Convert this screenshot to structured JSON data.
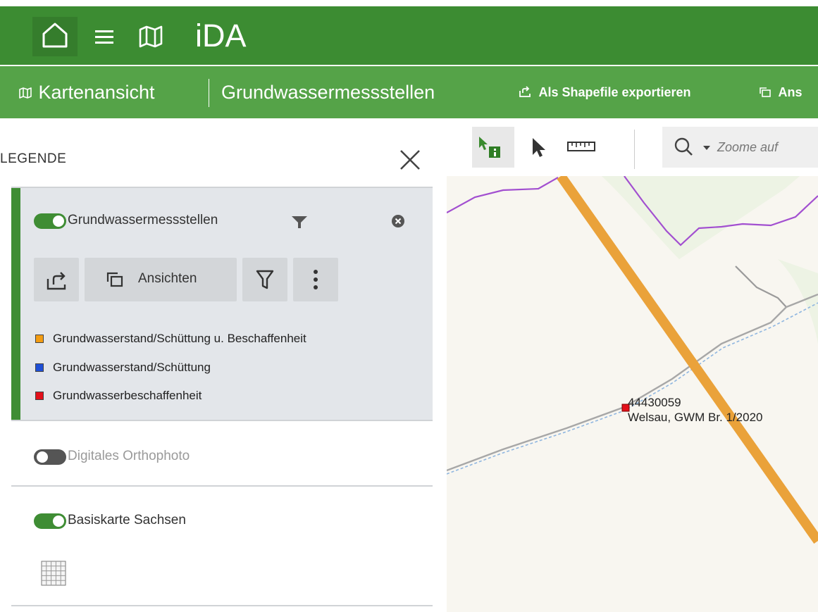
{
  "app": {
    "title": "iDA"
  },
  "subnav": {
    "view_label": "Kartenansicht",
    "dataset_title": "Grundwassermessstellen",
    "export_label": "Als Shapefile exportieren",
    "views_label": "Ans"
  },
  "legend": {
    "title": "LEGENDE",
    "layers": [
      {
        "name": "Grundwassermessstellen",
        "enabled": true,
        "views_button_label": "Ansichten",
        "entries": [
          {
            "label": "Grundwasserstand/Schüttung u. Beschaffenheit",
            "color": "#f39c12"
          },
          {
            "label": "Grundwasserstand/Schüttung",
            "color": "#1e4fd6"
          },
          {
            "label": "Grundwasserbeschaffenheit",
            "color": "#e3101a"
          }
        ]
      },
      {
        "name": "Digitales Orthophoto",
        "enabled": false
      },
      {
        "name": "Basiskarte Sachsen",
        "enabled": true
      }
    ]
  },
  "map": {
    "search_placeholder": "Zoome auf",
    "feature": {
      "id": "44430059",
      "name": "Welsau, GWM Br. 1/2020",
      "color": "#e3101a"
    }
  },
  "colors": {
    "primary": "#3c8c32",
    "secondary": "#55a348",
    "toggle_on": "#3f8d34",
    "toggle_off": "#555555"
  }
}
